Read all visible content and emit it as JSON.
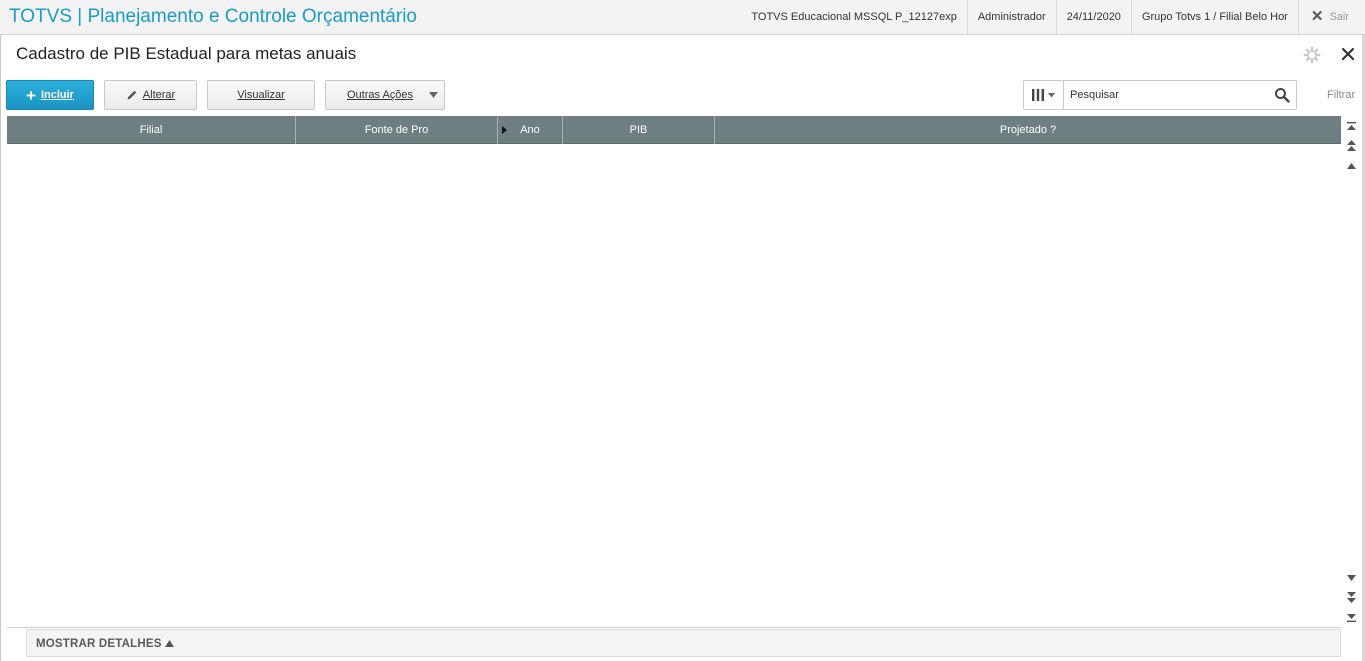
{
  "app": {
    "title": "TOTVS | Planejamento e Controle Orçamentário",
    "status": {
      "environment": "TOTVS Educacional MSSQL P_12127exp",
      "user": "Administrador",
      "date": "24/11/2020",
      "branch": "Grupo Totvs 1 / Filial Belo Hor",
      "exit_label": "Sair"
    }
  },
  "page": {
    "title": "Cadastro de PIB Estadual para metas anuais"
  },
  "toolbar": {
    "include_label": "Incluir",
    "edit_label": "Alterar",
    "view_label": "Visualizar",
    "more_actions_label": "Outras Ações"
  },
  "search": {
    "placeholder": "Pesquisar",
    "filter_label": "Filtrar"
  },
  "grid": {
    "columns": [
      "Filial",
      "Fonte de Pro",
      "Ano",
      "PIB",
      "Projetado ?"
    ],
    "rows": []
  },
  "details": {
    "label": "MOSTRAR DETALHES"
  },
  "colors": {
    "brand": "#1a9bc9",
    "primary_button": "#1a93c3",
    "grid_header": "#6f7e80"
  },
  "icons": [
    "plus-icon",
    "pencil-icon",
    "chevron-down-icon",
    "columns-icon",
    "search-icon",
    "gear-icon",
    "close-icon",
    "caret-up-icon"
  ]
}
